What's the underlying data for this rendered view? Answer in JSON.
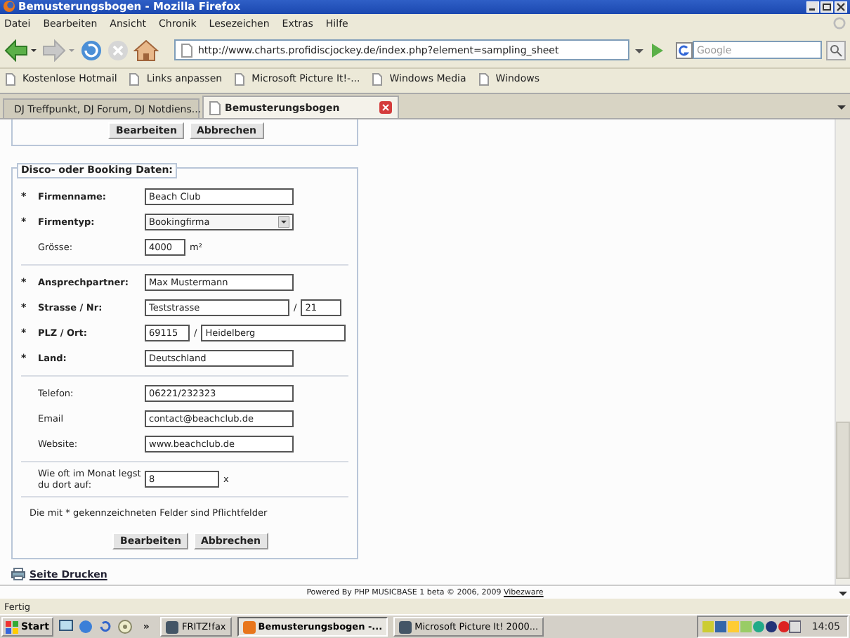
{
  "window": {
    "title": "Bemusterungsbogen - Mozilla Firefox"
  },
  "menu": [
    "Datei",
    "Bearbeiten",
    "Ansicht",
    "Chronik",
    "Lesezeichen",
    "Extras",
    "Hilfe"
  ],
  "toolbar": {
    "url": "http://www.charts.profidiscjockey.de/index.php?element=sampling_sheet",
    "search_placeholder": "Google"
  },
  "bookmarks": [
    "Kostenlose Hotmail",
    "Links anpassen",
    "Microsoft Picture It!-...",
    "Windows Media",
    "Windows"
  ],
  "tabs": [
    {
      "label": "DJ Treffpunkt, DJ Forum, DJ Notdiens...",
      "selected": false
    },
    {
      "label": "Bemusterungsbogen",
      "selected": true
    }
  ],
  "top_buttons": [
    "Bearbeiten",
    "Abbrechen"
  ],
  "form": {
    "legend": "Disco- oder Booking Daten:",
    "sections": [
      [
        {
          "marker": "*",
          "label": "Firmenname:",
          "kind": "text",
          "value": "Beach Club"
        },
        {
          "marker": "*",
          "label": "Firmentyp:",
          "kind": "select",
          "value": "Bookingfirma"
        },
        {
          "label": "Grösse:",
          "kind": "unit",
          "value": "4000",
          "unit": "m²"
        }
      ],
      [
        {
          "marker": "*",
          "label": "Ansprechpartner:",
          "kind": "text",
          "value": "Max Mustermann"
        },
        {
          "marker": "*",
          "label": "Strasse / Nr:",
          "kind": "pair",
          "value": "Teststrasse",
          "separator": "/",
          "value2": "21"
        },
        {
          "marker": "*",
          "label": "PLZ / Ort:",
          "kind": "pair_short",
          "value": "69115",
          "separator": "/",
          "value2": "Heidelberg"
        },
        {
          "marker": "*",
          "label": "Land:",
          "kind": "text",
          "value": "Deutschland"
        }
      ],
      [
        {
          "label": "Telefon:",
          "kind": "text",
          "value": "06221/232323"
        },
        {
          "label": "Email",
          "kind": "text",
          "value": "contact@beachclub.de"
        },
        {
          "label": "Website:",
          "kind": "text",
          "value": "www.beachclub.de"
        }
      ],
      [
        {
          "label": "Wie oft im Monat legst du dort auf:",
          "kind": "unit_wide",
          "value": "8",
          "unit": "x"
        }
      ]
    ],
    "note": "Die mit * gekennzeichneten Felder sind Pflichtfelder",
    "buttons": [
      "Bearbeiten",
      "Abbrechen"
    ]
  },
  "print_link": "Seite Drucken",
  "footer": {
    "text": "Powered By PHP MUSICBASE 1 beta © 2006, 2009",
    "link": "Vibezware"
  },
  "status_bar": "Fertig",
  "taskbar": {
    "start": "Start",
    "more": "»",
    "tasks": [
      {
        "label": "FRITZ!fax",
        "selected": false
      },
      {
        "label": "Bemusterungsbogen -...",
        "selected": true
      },
      {
        "label": "Microsoft Picture It! 2000...",
        "selected": false
      }
    ],
    "clock": "14:05"
  }
}
